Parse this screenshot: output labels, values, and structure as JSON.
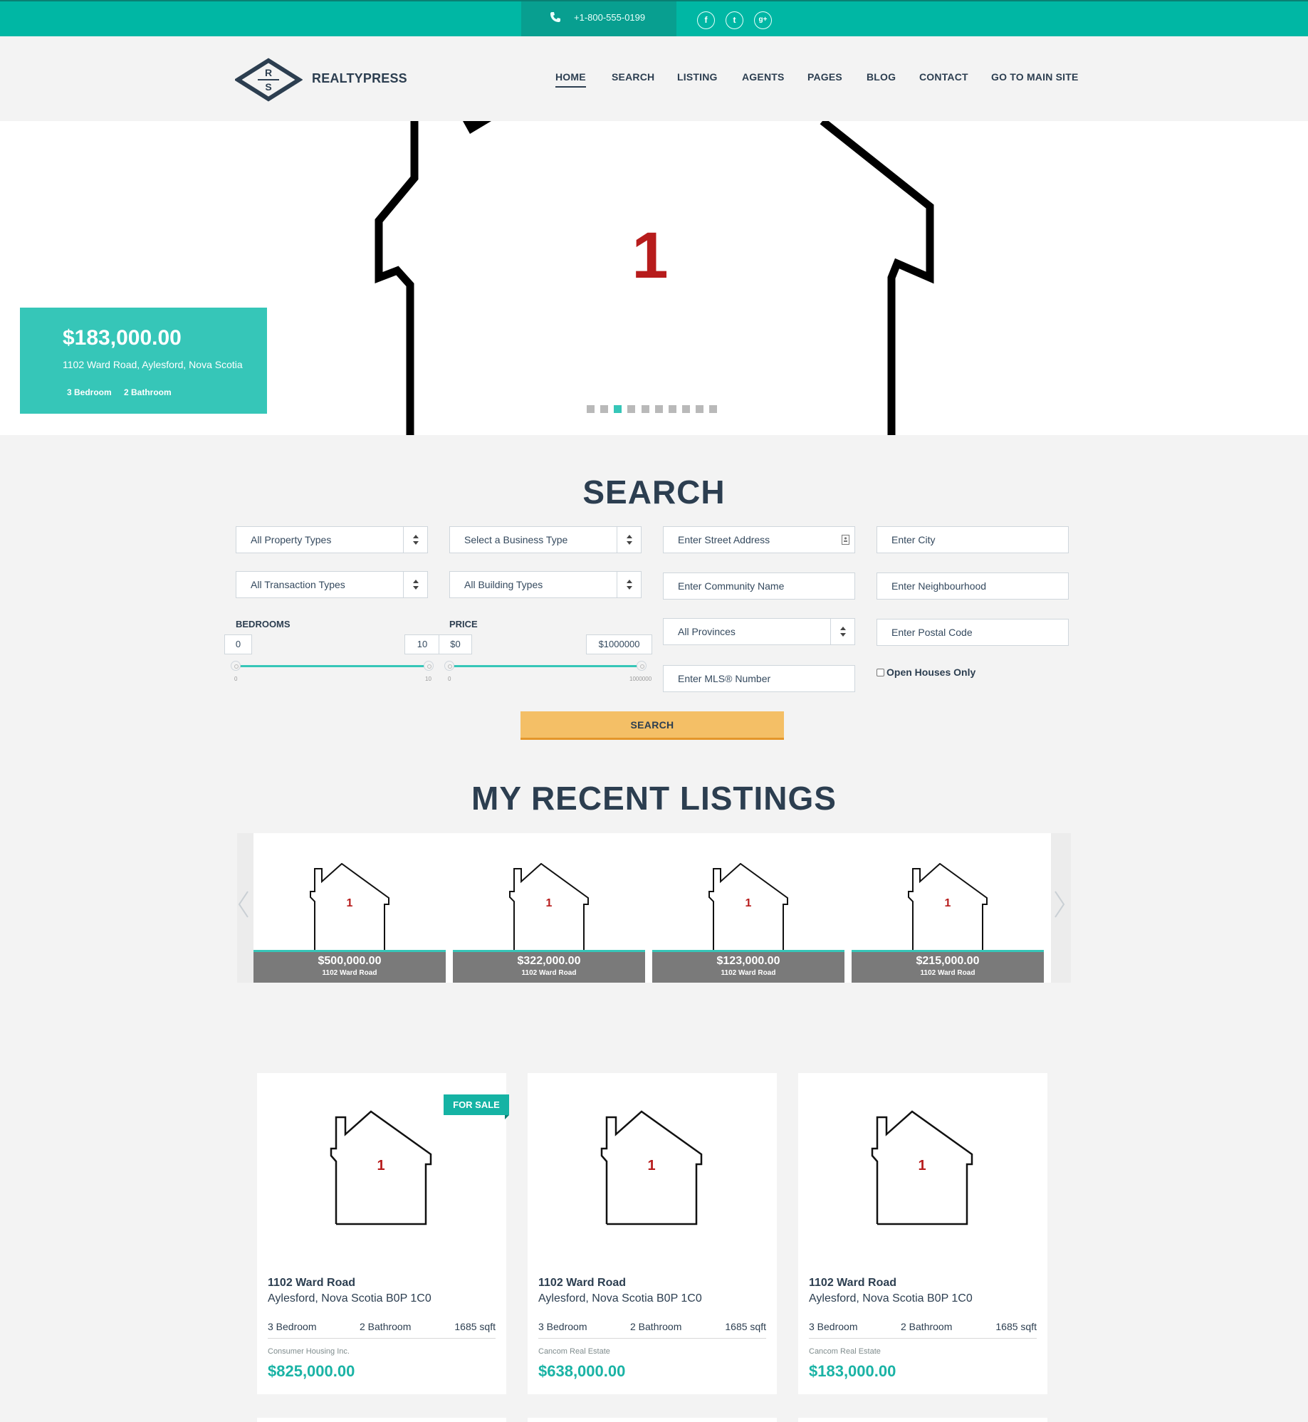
{
  "topbar": {
    "phone": "+1-800-555-0199",
    "social": [
      {
        "icon": "facebook-icon",
        "glyph": "f"
      },
      {
        "icon": "twitter-icon",
        "glyph": "t"
      },
      {
        "icon": "google-plus-icon",
        "glyph": "g+"
      }
    ]
  },
  "header": {
    "logo_letters": [
      "R",
      "S"
    ],
    "brand": "REALTYPRESS",
    "nav": [
      "HOME",
      "SEARCH",
      "LISTING",
      "AGENTS",
      "PAGES",
      "BLOG",
      "CONTACT",
      "GO TO MAIN SITE"
    ],
    "active_nav": "HOME"
  },
  "hero": {
    "image_number": "1",
    "price": "$183,000.00",
    "address": "1102 Ward Road, Aylesford, Nova Scotia",
    "bedrooms": "3 Bedroom",
    "bathrooms": "2 Bathroom",
    "slide_count": 10,
    "active_slide": 3
  },
  "search": {
    "title": "SEARCH",
    "selects": {
      "property_type": "All Property Types",
      "business_type": "Select a Business Type",
      "transaction_type": "All Transaction Types",
      "building_type": "All Building Types",
      "province": "All Provinces"
    },
    "inputs": {
      "street": "Enter Street Address",
      "city": "Enter City",
      "community": "Enter Community Name",
      "neighbourhood": "Enter Neighbourhood",
      "postal": "Enter Postal Code",
      "mls": "Enter MLS® Number"
    },
    "bedrooms": {
      "label": "BEDROOMS",
      "min": "0",
      "max": "10",
      "min_tick": "0",
      "max_tick": "10"
    },
    "price": {
      "label": "PRICE",
      "min": "$0",
      "max": "$1000000",
      "min_tick": "0",
      "max_tick": "1000000"
    },
    "open_houses": "Open Houses Only",
    "button": "SEARCH"
  },
  "recent": {
    "title": "MY RECENT LISTINGS",
    "items": [
      {
        "price": "$500,000.00",
        "address": "1102 Ward Road",
        "number": "1"
      },
      {
        "price": "$322,000.00",
        "address": "1102 Ward Road",
        "number": "1"
      },
      {
        "price": "$123,000.00",
        "address": "1102 Ward Road",
        "number": "1"
      },
      {
        "price": "$215,000.00",
        "address": "1102 Ward Road",
        "number": "1"
      }
    ]
  },
  "listings": [
    {
      "tag": "FOR SALE",
      "number": "1",
      "street": "1102 Ward Road",
      "city": "Aylesford, Nova Scotia B0P 1C0",
      "bed": "3 Bedroom",
      "bath": "2 Bathroom",
      "sqft": "1685 sqft",
      "broker": "Consumer Housing Inc.",
      "price": "$825,000.00"
    },
    {
      "tag": "",
      "number": "1",
      "street": "1102 Ward Road",
      "city": "Aylesford, Nova Scotia B0P 1C0",
      "bed": "3 Bedroom",
      "bath": "2 Bathroom",
      "sqft": "1685 sqft",
      "broker": "Cancom Real Estate",
      "price": "$638,000.00"
    },
    {
      "tag": "",
      "number": "1",
      "street": "1102 Ward Road",
      "city": "Aylesford, Nova Scotia B0P 1C0",
      "bed": "3 Bedroom",
      "bath": "2 Bathroom",
      "sqft": "1685 sqft",
      "broker": "Cancom Real Estate",
      "price": "$183,000.00"
    }
  ],
  "colors": {
    "accent": "#00b7a4",
    "price_accent": "#1ab3a5",
    "button": "#f4bf66",
    "text": "#2c3e50"
  }
}
